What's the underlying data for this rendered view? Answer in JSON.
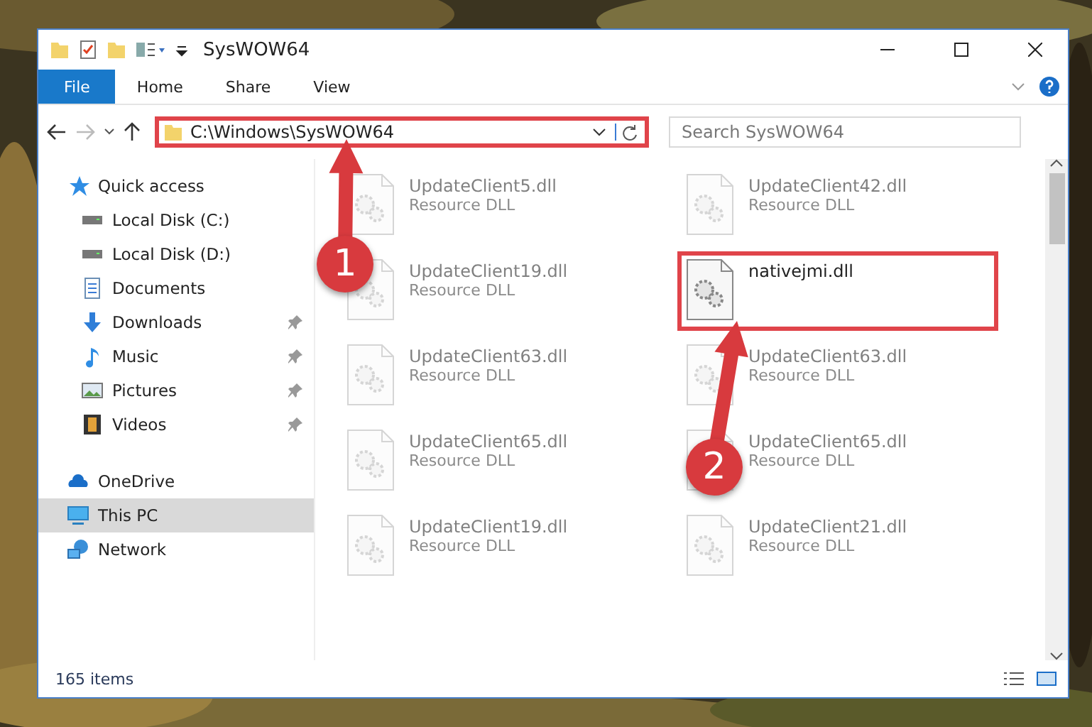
{
  "window": {
    "title": "SysWOW64"
  },
  "ribbon_tabs": [
    {
      "label": "File",
      "kind": "file"
    },
    {
      "label": "Home",
      "kind": "tab"
    },
    {
      "label": "Share",
      "kind": "tab"
    },
    {
      "label": "View",
      "kind": "tab"
    }
  ],
  "address": {
    "path": "C:\\Windows\\SysWOW64",
    "annotated": true
  },
  "search": {
    "placeholder": "Search SysWOW64"
  },
  "nav": [
    {
      "label": "Quick access",
      "selected": false,
      "pinned": false,
      "children": [
        {
          "label": "Local Disk (C:)",
          "selected": false,
          "pinned": false
        },
        {
          "label": "Local Disk (D:)",
          "selected": false,
          "pinned": false
        },
        {
          "label": "Documents",
          "selected": false,
          "pinned": false
        },
        {
          "label": "Downloads",
          "selected": false,
          "pinned": true
        },
        {
          "label": "Music",
          "selected": false,
          "pinned": true
        },
        {
          "label": "Pictures",
          "selected": false,
          "pinned": true
        },
        {
          "label": "Videos",
          "selected": false,
          "pinned": true
        }
      ]
    },
    {
      "label": "OneDrive",
      "selected": false,
      "pinned": false
    },
    {
      "label": "This PC",
      "selected": true,
      "pinned": false
    },
    {
      "label": "Network",
      "selected": false,
      "pinned": false
    }
  ],
  "files": [
    {
      "name": "UpdateClient5.dll",
      "type": "Resource DLL",
      "blurred": true,
      "annotated": false
    },
    {
      "name": "UpdateClient42.dll",
      "type": "Resource DLL",
      "blurred": true,
      "annotated": false
    },
    {
      "name": "UpdateClient19.dll",
      "type": "Resource DLL",
      "blurred": true,
      "annotated": false
    },
    {
      "name": "nativejmi.dll",
      "blurred": false,
      "annotated": true
    },
    {
      "name": "UpdateClient63.dll",
      "type": "Resource DLL",
      "blurred": true,
      "annotated": false
    },
    {
      "name": "UpdateClient63.dll",
      "type": "Resource DLL",
      "blurred": true,
      "annotated": false
    },
    {
      "name": "UpdateClient65.dll",
      "type": "Resource DLL",
      "blurred": true,
      "annotated": false
    },
    {
      "name": "UpdateClient65.dll",
      "type": "Resource DLL",
      "blurred": true,
      "annotated": false
    },
    {
      "name": "UpdateClient19.dll",
      "type": "Resource DLL",
      "blurred": true,
      "annotated": false
    },
    {
      "name": "UpdateClient21.dll",
      "type": "Resource DLL",
      "blurred": true,
      "annotated": false
    }
  ],
  "status_bar": {
    "count": "165 items"
  },
  "annotations": [
    {
      "number": "1"
    },
    {
      "number": "2"
    }
  ]
}
